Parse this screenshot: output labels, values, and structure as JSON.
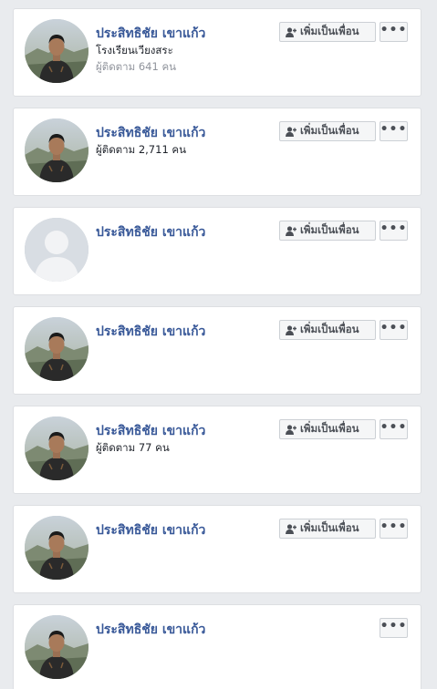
{
  "people": [
    {
      "name": "ประสิทธิชัย เขาแก้ว",
      "school": "โรงเรียนเวียงสระ",
      "followers": "ผู้ติดตาม 641 คน",
      "add_label": "เพิ่มเป็นเพื่อน",
      "show_add": true,
      "photo": "person-photo-icon"
    },
    {
      "name": "ประสิทธิชัย เขาแก้ว",
      "school": "",
      "followers": "ผู้ติดตาม 2,711 คน",
      "add_label": "เพิ่มเป็นเพื่อน",
      "show_add": true,
      "photo": "person-photo-icon"
    },
    {
      "name": "ประสิทธิชัย เขาแก้ว",
      "school": "",
      "followers": "",
      "add_label": "เพิ่มเป็นเพื่อน",
      "show_add": true,
      "photo": "default-avatar-icon"
    },
    {
      "name": "ประสิทธิชัย เขาแก้ว",
      "school": "",
      "followers": "",
      "add_label": "เพิ่มเป็นเพื่อน",
      "show_add": true,
      "photo": "person-photo-icon"
    },
    {
      "name": "ประสิทธิชัย เขาแก้ว",
      "school": "",
      "followers": "ผู้ติดตาม 77 คน",
      "add_label": "เพิ่มเป็นเพื่อน",
      "show_add": true,
      "photo": "person-photo-icon"
    },
    {
      "name": "ประสิทธิชัย เขาแก้ว",
      "school": "",
      "followers": "",
      "add_label": "เพิ่มเป็นเพื่อน",
      "show_add": true,
      "photo": "person-photo-icon"
    },
    {
      "name": "ประสิทธิชัย เขาแก้ว",
      "school": "",
      "followers": "",
      "add_label": "",
      "show_add": false,
      "photo": "person-photo-icon"
    }
  ],
  "more_label": "•••",
  "colors": {
    "background": "#e9ebee",
    "name": "#385898",
    "button_bg": "#f5f6f7",
    "button_border": "#ccd0d5"
  }
}
